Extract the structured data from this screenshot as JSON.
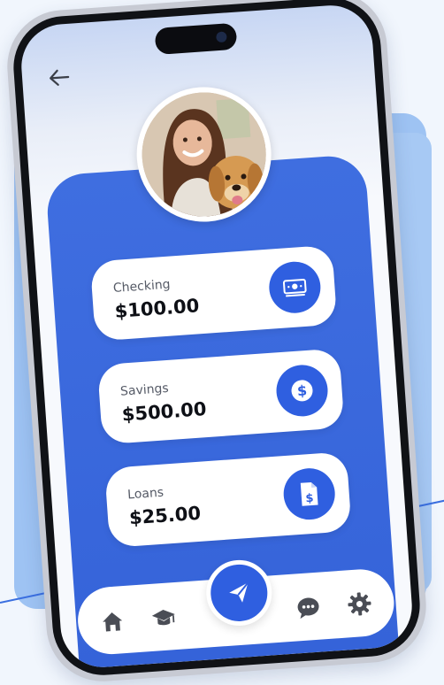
{
  "header": {
    "back_icon": "arrow-left-icon"
  },
  "profile": {
    "avatar_alt": ""
  },
  "accounts": [
    {
      "label": "Checking",
      "amount": "$100.00",
      "icon": "cash-icon"
    },
    {
      "label": "Savings",
      "amount": "$500.00",
      "icon": "dollar-icon"
    },
    {
      "label": "Loans",
      "amount": "$25.00",
      "icon": "invoice-icon"
    }
  ],
  "nav": {
    "items": [
      "home-icon",
      "graduation-cap-icon",
      "send-icon",
      "chat-icon",
      "gear-icon"
    ]
  },
  "colors": {
    "accent": "#2f5fe0",
    "panel": "#3f6ee0",
    "background": "#f1f6fd",
    "card": "#ffffff"
  }
}
